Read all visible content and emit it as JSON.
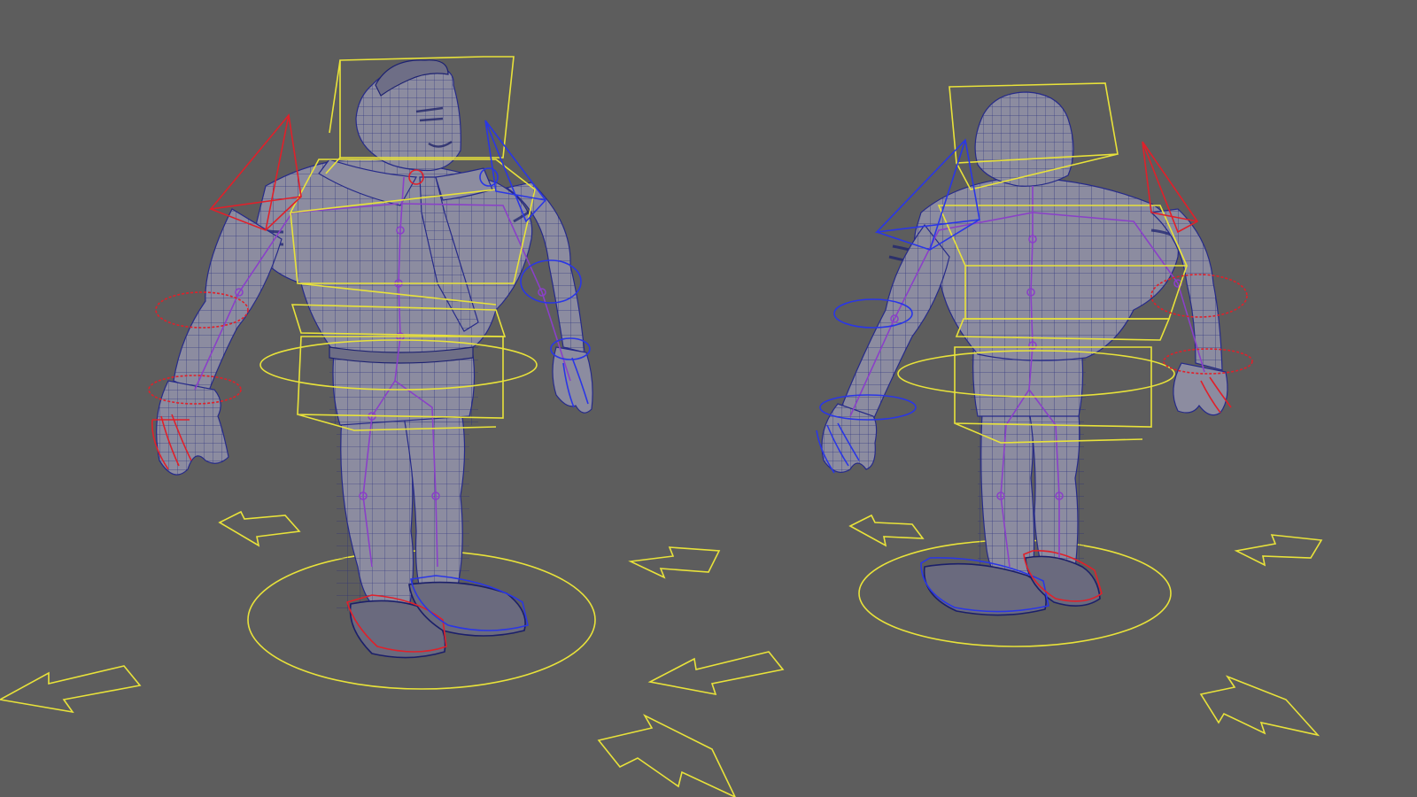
{
  "viewport": {
    "background": "#5d5d5d",
    "views": [
      "front-three-quarter",
      "back-three-quarter"
    ]
  },
  "colors": {
    "control_yellow": "#e8e23a",
    "control_red": "#e0202a",
    "control_blue": "#2a36e6",
    "joint_purple": "#8a40c8",
    "mesh_fill": "#8c8ca0",
    "wireframe": "#242a7a"
  },
  "rig": {
    "character": "cartoon-brute-in-uniform",
    "control_sides": {
      "left": "red",
      "right": "blue",
      "center": "yellow"
    }
  }
}
